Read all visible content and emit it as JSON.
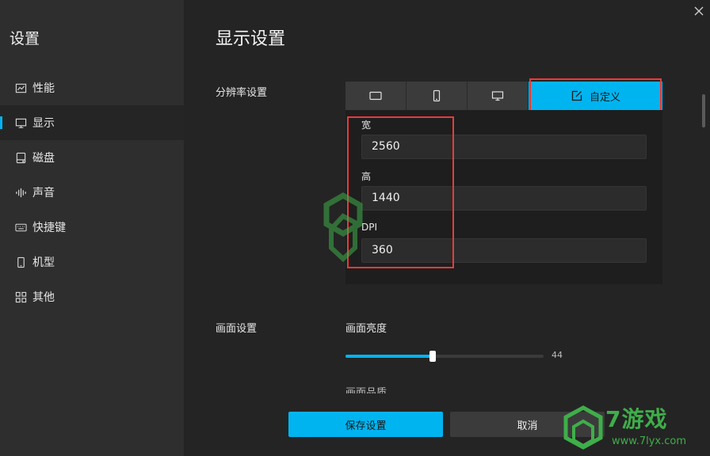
{
  "sidebar": {
    "title": "设置",
    "items": [
      {
        "label": "性能",
        "icon": "chart-line-icon"
      },
      {
        "label": "显示",
        "icon": "monitor-icon",
        "active": true
      },
      {
        "label": "磁盘",
        "icon": "disk-icon"
      },
      {
        "label": "声音",
        "icon": "sound-wave-icon"
      },
      {
        "label": "快捷键",
        "icon": "keyboard-icon"
      },
      {
        "label": "机型",
        "icon": "phone-icon"
      },
      {
        "label": "其他",
        "icon": "grid-icon"
      }
    ]
  },
  "main": {
    "title": "显示设置",
    "resolution": {
      "label": "分辨率设置",
      "tabs": [
        {
          "icon": "tablet-landscape-icon"
        },
        {
          "icon": "phone-portrait-icon"
        },
        {
          "icon": "desktop-icon"
        },
        {
          "label": "自定义",
          "icon": "edit-icon",
          "selected": true
        }
      ],
      "width": {
        "label": "宽",
        "value": "2560"
      },
      "height": {
        "label": "高",
        "value": "1440"
      },
      "dpi": {
        "label": "DPI",
        "value": "360"
      }
    },
    "picture": {
      "label": "画面设置",
      "brightness": {
        "label": "画面亮度",
        "value": 44,
        "max": 100,
        "value_text": "44"
      }
    },
    "buttons": {
      "save": "保存设置",
      "cancel": "取消"
    }
  },
  "colors": {
    "accent": "#00b4f0",
    "highlight": "#e83b3b",
    "watermark": "#3fae4a"
  },
  "watermark": {
    "brand": "7游戏",
    "url": "www.7lyx.com"
  }
}
